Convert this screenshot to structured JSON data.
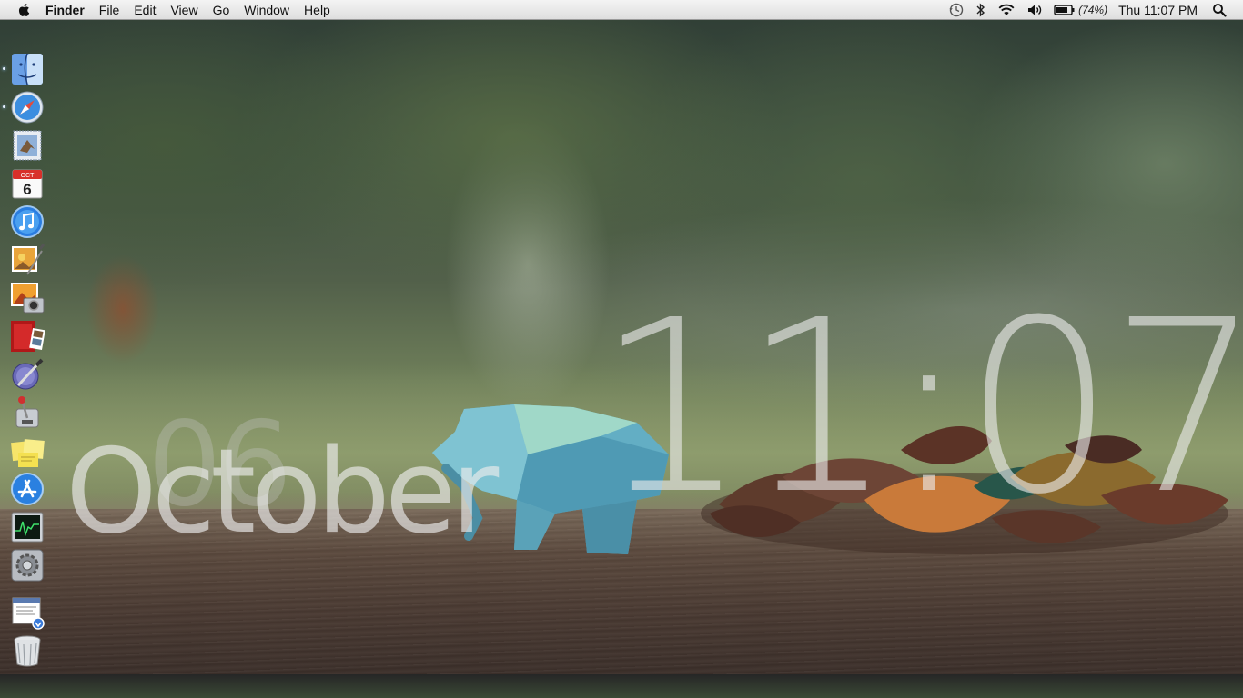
{
  "menubar": {
    "app_name": "Finder",
    "items": [
      "File",
      "Edit",
      "View",
      "Go",
      "Window",
      "Help"
    ],
    "battery_percent": "(74%)",
    "clock": "Thu 11:07 PM"
  },
  "desktop_clock": {
    "time": "11:07",
    "day": "06",
    "month": "October"
  },
  "dock": {
    "items": [
      {
        "name": "Finder",
        "icon": "finder-icon",
        "running": true
      },
      {
        "name": "Safari",
        "icon": "safari-icon",
        "running": true
      },
      {
        "name": "Mail",
        "icon": "mail-icon",
        "running": false
      },
      {
        "name": "iCal",
        "icon": "calendar-icon",
        "running": false,
        "date_label": "6",
        "month_label": "OCT"
      },
      {
        "name": "iTunes",
        "icon": "itunes-icon",
        "running": false
      },
      {
        "name": "iPhoto",
        "icon": "iphoto-icon",
        "running": false
      },
      {
        "name": "Image Capture",
        "icon": "image-capture-icon",
        "running": false
      },
      {
        "name": "Photo Booth",
        "icon": "photo-booth-icon",
        "running": false
      },
      {
        "name": "Xcode",
        "icon": "xcode-icon",
        "running": false
      },
      {
        "name": "Instruments",
        "icon": "instruments-icon",
        "running": false
      },
      {
        "name": "Stickies",
        "icon": "stickies-icon",
        "running": false
      },
      {
        "name": "App Store",
        "icon": "app-store-icon",
        "running": false
      },
      {
        "name": "Activity Monitor",
        "icon": "activity-monitor-icon",
        "running": false
      },
      {
        "name": "System Preferences",
        "icon": "system-preferences-icon",
        "running": false
      },
      {
        "name": "Downloads",
        "icon": "downloads-stack-icon",
        "running": false
      },
      {
        "name": "Trash",
        "icon": "trash-icon",
        "running": false
      }
    ]
  },
  "colors": {
    "menubar_top": "#f4f4f4",
    "menubar_bottom": "#dedede",
    "clock_overlay": "#ebebeb"
  }
}
